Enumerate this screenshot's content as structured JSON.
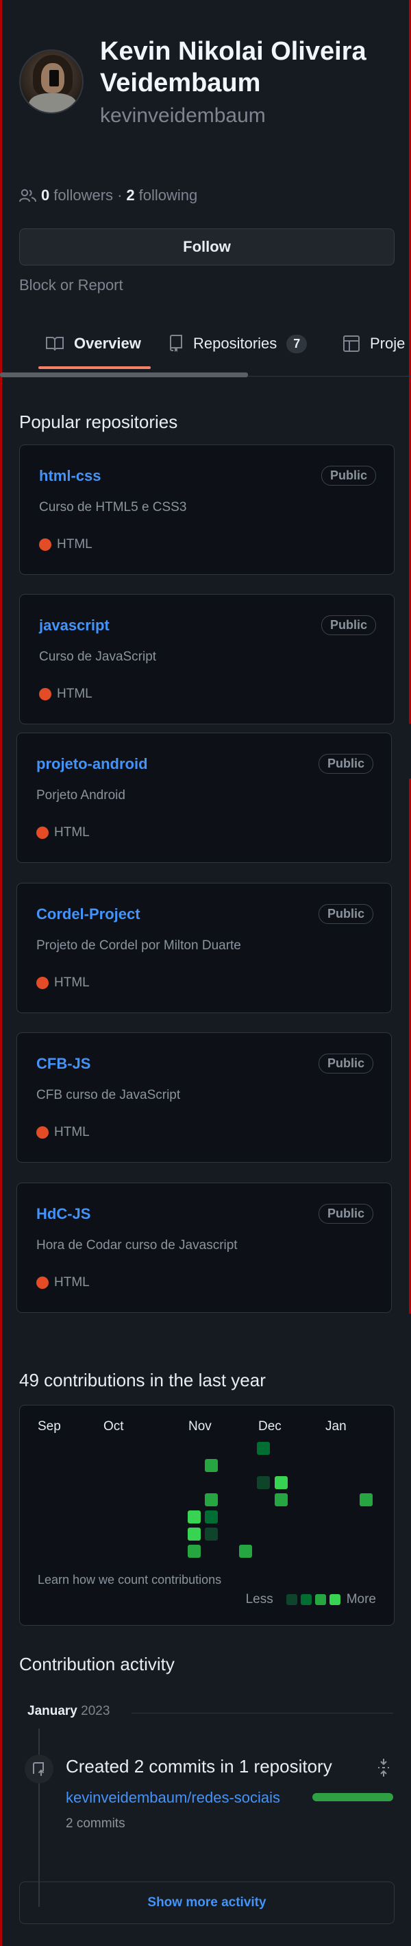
{
  "profile": {
    "name": "Kevin Nikolai Oliveira Veidembaum",
    "login": "kevinveidembaum",
    "followers_count": "0",
    "followers_label": "followers",
    "separator": "·",
    "following_count": "2",
    "following_label": "following",
    "follow_button": "Follow",
    "block_report": "Block or Report"
  },
  "tabs": [
    {
      "label": "Overview",
      "icon": "book-icon"
    },
    {
      "label": "Repositories",
      "icon": "repo-icon",
      "counter": "7"
    },
    {
      "label": "Proje",
      "icon": "table-icon"
    }
  ],
  "popular": {
    "title": "Popular repositories",
    "repos": [
      {
        "name": "html-css",
        "badge": "Public",
        "desc": "Curso de HTML5 e CSS3",
        "lang": "HTML"
      },
      {
        "name": "javascript",
        "badge": "Public",
        "desc": "Curso de JavaScript",
        "lang": "HTML"
      },
      {
        "name": "projeto-android",
        "badge": "Public",
        "desc": "Porjeto Android",
        "lang": "HTML"
      },
      {
        "name": "Cordel-Project",
        "badge": "Public",
        "desc": "Projeto de Cordel por Milton Duarte",
        "lang": "HTML"
      },
      {
        "name": "CFB-JS",
        "badge": "Public",
        "desc": "CFB curso de JavaScript",
        "lang": "HTML"
      },
      {
        "name": "HdC-JS",
        "badge": "Public",
        "desc": "Hora de Codar curso de Javascript",
        "lang": "HTML"
      }
    ]
  },
  "colors": {
    "accent_link": "#4493f8",
    "html_lang": "#e34c26",
    "tab_underline": "#f78166",
    "green_1": "#0e4429",
    "green_2": "#006d32",
    "green_3": "#26a641",
    "green_4": "#39d353"
  },
  "contributions": {
    "title": "49 contributions in the last year",
    "months": [
      "Sep",
      "Oct",
      "Nov",
      "Dec",
      "Jan"
    ],
    "learn": "Learn how we count contributions",
    "less": "Less",
    "more": "More"
  },
  "activity": {
    "title": "Contribution activity",
    "month": "January",
    "year": "2023",
    "event_title": "Created 2 commits in 1 repository",
    "repo": "kevinveidembaum/redes-sociais",
    "commits": "2 commits",
    "show_more": "Show more activity"
  }
}
